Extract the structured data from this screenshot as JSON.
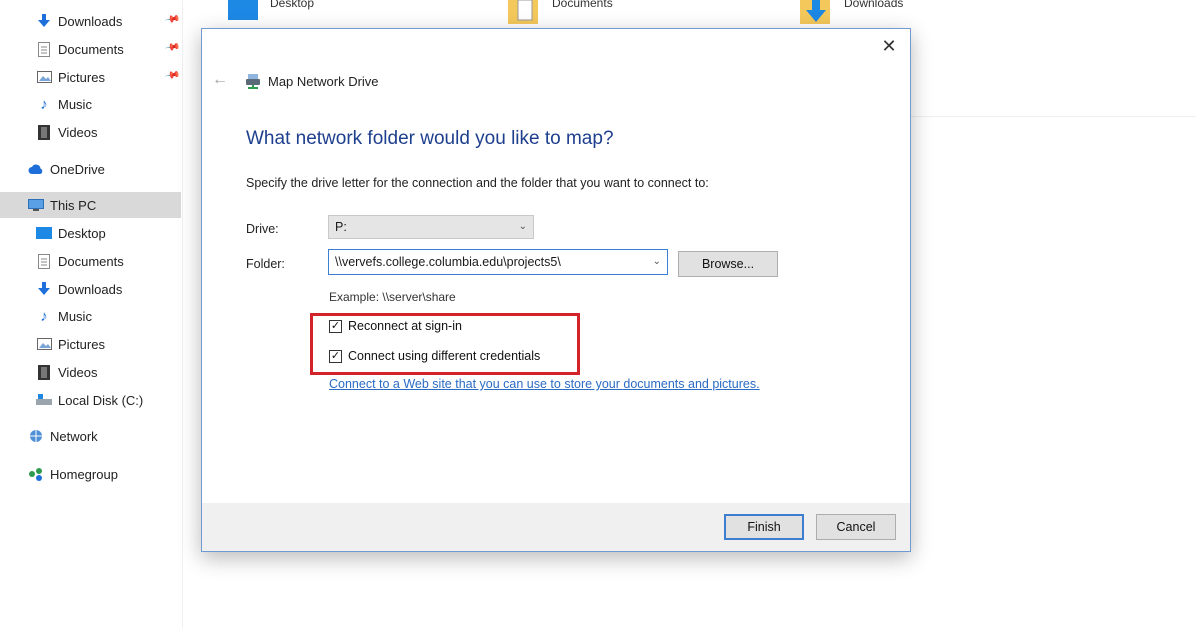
{
  "explorer": {
    "tiles": [
      {
        "label": "Desktop"
      },
      {
        "label": "Documents"
      },
      {
        "label": "Downloads"
      }
    ],
    "nav": [
      {
        "label": "Downloads",
        "icon": "download-arrow-icon",
        "pinned": true
      },
      {
        "label": "Documents",
        "icon": "document-icon",
        "pinned": true
      },
      {
        "label": "Pictures",
        "icon": "pictures-icon",
        "pinned": true
      },
      {
        "label": "Music",
        "icon": "music-note-icon"
      },
      {
        "label": "Videos",
        "icon": "video-icon"
      },
      {
        "label": "OneDrive",
        "icon": "cloud-icon"
      },
      {
        "label": "This PC",
        "icon": "computer-icon",
        "selected": true
      },
      {
        "label": "Desktop",
        "icon": "desktop-icon"
      },
      {
        "label": "Documents",
        "icon": "document-icon"
      },
      {
        "label": "Downloads",
        "icon": "download-arrow-icon"
      },
      {
        "label": "Music",
        "icon": "music-note-icon"
      },
      {
        "label": "Pictures",
        "icon": "pictures-icon"
      },
      {
        "label": "Videos",
        "icon": "video-icon"
      },
      {
        "label": "Local Disk (C:)",
        "icon": "disk-icon"
      },
      {
        "label": "Network",
        "icon": "network-icon"
      },
      {
        "label": "Homegroup",
        "icon": "homegroup-icon"
      }
    ]
  },
  "dialog": {
    "title": "Map Network Drive",
    "close_glyph": "✕",
    "back_glyph": "←",
    "heading": "What network folder would you like to map?",
    "instruction": "Specify the drive letter for the connection and the folder that you want to connect to:",
    "drive_label": "Drive:",
    "drive_value": "P:",
    "folder_label": "Folder:",
    "folder_value": "\\\\vervefs.college.columbia.edu\\projects5\\",
    "browse_label": "Browse...",
    "example": "Example: \\\\server\\share",
    "reconnect_label": "Reconnect at sign-in",
    "reconnect_checked": true,
    "credentials_label": "Connect using different credentials",
    "credentials_checked": true,
    "weblink": "Connect to a Web site that you can use to store your documents and pictures.",
    "finish_label": "Finish",
    "cancel_label": "Cancel"
  },
  "colors": {
    "heading": "#1e3f8e",
    "link": "#2a6bc4",
    "highlight": "#d2232a",
    "accent": "#3c7fd0"
  }
}
